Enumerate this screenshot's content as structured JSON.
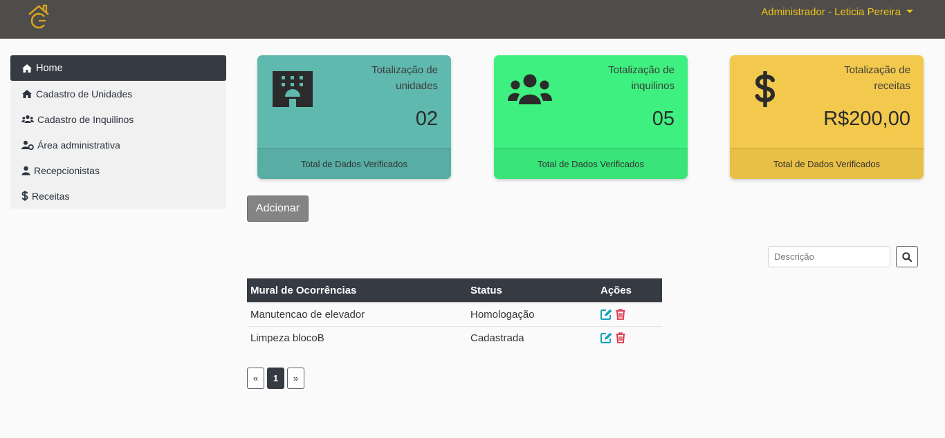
{
  "navbar": {
    "user_label": "Administrador - Leticia Pereira"
  },
  "sidebar": {
    "items": [
      {
        "label": "Home",
        "icon": "home-icon"
      },
      {
        "label": "Cadastro de Unidades",
        "icon": "home-icon"
      },
      {
        "label": "Cadastro de Inquilinos",
        "icon": "users-icon"
      },
      {
        "label": "Área administrativa",
        "icon": "user-cog-icon"
      },
      {
        "label": "Recepcionistas",
        "icon": "user-icon"
      },
      {
        "label": "Receitas",
        "icon": "dollar-icon"
      }
    ]
  },
  "cards": [
    {
      "title": "Totalização de unidades",
      "value": "02",
      "footer": "Total de Dados Verificados",
      "icon": "building-icon",
      "color": "#5fb9ae"
    },
    {
      "title": "Totalização de inquilinos",
      "value": "05",
      "footer": "Total de Dados Verificados",
      "icon": "users-icon",
      "color": "#3ef07f"
    },
    {
      "title": "Totalização de receitas",
      "value": "R$200,00",
      "footer": "Total de Dados Verificados",
      "icon": "dollar-icon",
      "color": "#f2c94c"
    }
  ],
  "add_button": "Adcionar",
  "search": {
    "placeholder": "Descrição"
  },
  "table": {
    "headers": [
      "Mural de Ocorrências",
      "Status",
      "Ações"
    ],
    "rows": [
      {
        "description": "Manutencao de elevador",
        "status": "Homologação"
      },
      {
        "description": "Limpeza blocoB",
        "status": "Cadastrada"
      }
    ]
  },
  "pagination": {
    "prev": "«",
    "current": "1",
    "next": "»"
  },
  "colors": {
    "navbar": "#4e4d4b",
    "accent": "#f0c419",
    "dark": "#363a42",
    "edit": "#17a2b8",
    "delete": "#dc3545"
  }
}
